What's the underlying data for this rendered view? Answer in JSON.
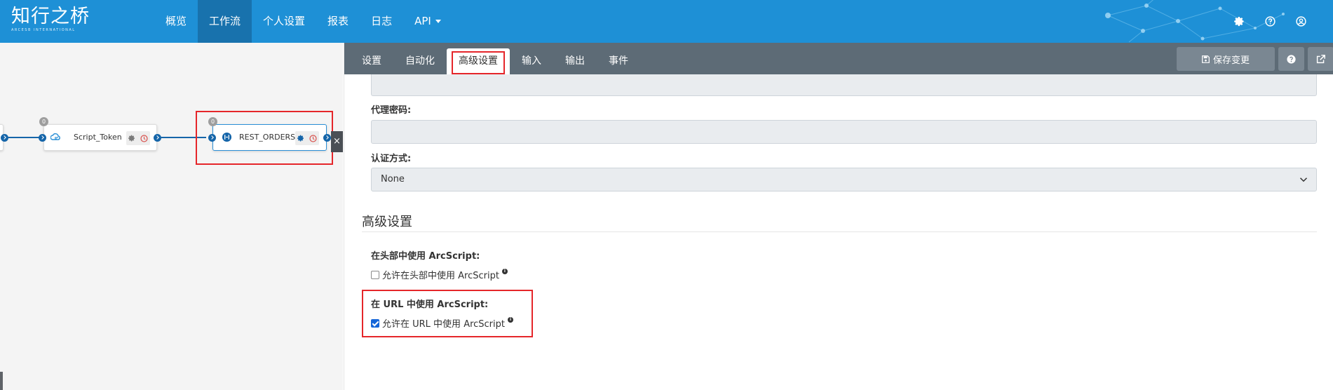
{
  "brand": {
    "name": "知行之桥",
    "subtitle": "ARCESB INTERNATIONAL"
  },
  "nav": {
    "items": [
      {
        "label": "概览",
        "active": false
      },
      {
        "label": "工作流",
        "active": true
      },
      {
        "label": "个人设置",
        "active": false
      },
      {
        "label": "报表",
        "active": false
      },
      {
        "label": "日志",
        "active": false
      }
    ],
    "api_label": "API"
  },
  "top_icons": [
    "gear-icon",
    "help-icon",
    "user-icon"
  ],
  "canvas": {
    "close_label": "×",
    "nodes": [
      {
        "label": "Script_Token",
        "badge": "0",
        "icon": "script-icon"
      },
      {
        "label": "REST_ORDERS",
        "badge": "0",
        "icon": "rest-icon"
      }
    ]
  },
  "tabs": [
    {
      "label": "设置",
      "active": false
    },
    {
      "label": "自动化",
      "active": false
    },
    {
      "label": "高级设置",
      "active": true
    },
    {
      "label": "输入",
      "active": false
    },
    {
      "label": "输出",
      "active": false
    },
    {
      "label": "事件",
      "active": false
    }
  ],
  "toolbar": {
    "save_label": "保存变更"
  },
  "form": {
    "proxy_password_label": "代理密码:",
    "proxy_password_value": "",
    "auth_label": "认证方式:",
    "auth_value": "None",
    "section_title": "高级设置",
    "header_arcscript_label": "在头部中使用 ArcScript:",
    "header_arcscript_check_label": "允许在头部中使用 ArcScript",
    "header_arcscript_checked": false,
    "url_arcscript_label": "在 URL 中使用 ArcScript:",
    "url_arcscript_check_label": "允许在 URL 中使用 ArcScript",
    "url_arcscript_checked": true
  },
  "colors": {
    "navbar": "#1e90d6",
    "nav_active": "#1872ad",
    "tabbar": "#5d6b76",
    "highlight": "#e5262a",
    "port": "#1565a9"
  }
}
